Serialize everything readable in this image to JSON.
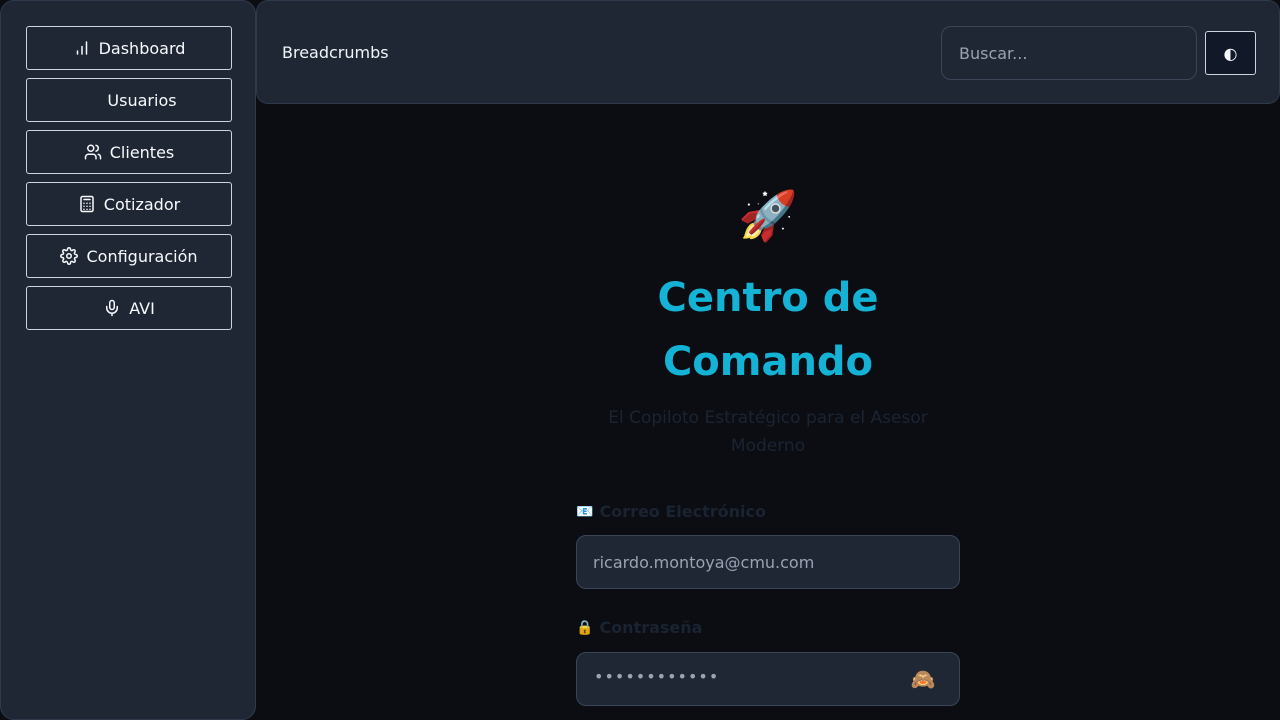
{
  "sidebar": {
    "items": [
      {
        "label": "Dashboard",
        "icon": "bar-chart-icon"
      },
      {
        "label": "Usuarios",
        "icon": ""
      },
      {
        "label": "Clientes",
        "icon": "users-icon"
      },
      {
        "label": "Cotizador",
        "icon": "calculator-icon"
      },
      {
        "label": "Configuración",
        "icon": "gear-icon"
      },
      {
        "label": "AVI",
        "icon": "microphone-icon"
      }
    ]
  },
  "header": {
    "breadcrumbs": "Breadcrumbs",
    "search_placeholder": "Buscar...",
    "theme_toggle_glyph": "◐"
  },
  "main": {
    "emoji": "🚀",
    "title_line1": "Centro de",
    "title_line2": "Comando",
    "subtitle_line1": "El Copiloto Estratégico para el Asesor",
    "subtitle_line2": "Moderno",
    "email_label_icon": "📧",
    "email_label": "Correo Electrónico",
    "email_value": "ricardo.montoya@cmu.com",
    "password_label_icon": "🔒",
    "password_label": "Contraseña",
    "password_masked": "••••••••••••",
    "show_password_glyph": "🙈"
  },
  "colors": {
    "accent": "#14b3d6",
    "background": "#0b0d12",
    "panel": "#1f2735"
  }
}
